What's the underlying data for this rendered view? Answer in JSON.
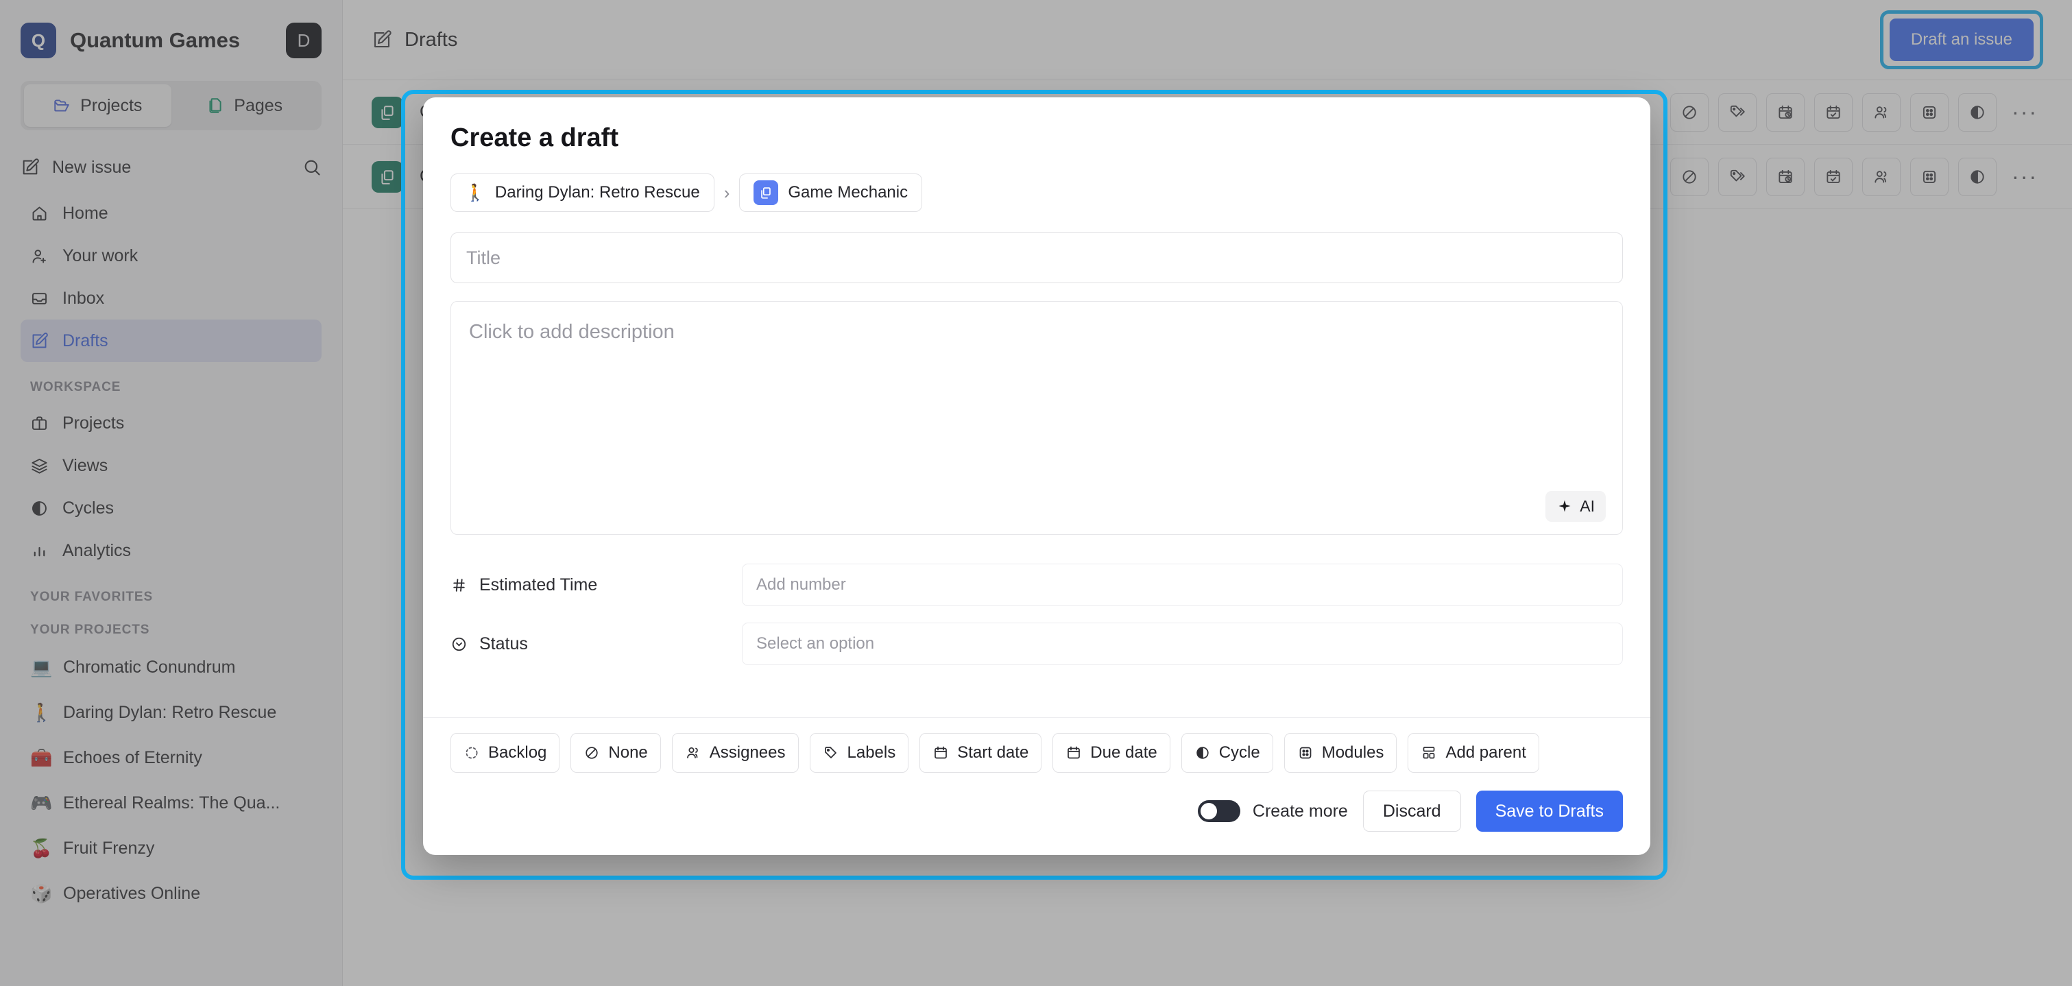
{
  "workspace": {
    "logo_letter": "Q",
    "name": "Quantum Games",
    "avatar_letter": "D"
  },
  "sidebar": {
    "segments": [
      {
        "label": "Projects",
        "icon": "folder-open-icon",
        "active": true
      },
      {
        "label": "Pages",
        "icon": "pages-icon",
        "active": false
      }
    ],
    "new_issue_label": "New issue",
    "search_icon": "search-icon",
    "nav": [
      {
        "label": "Home",
        "icon": "home-icon",
        "active": false
      },
      {
        "label": "Your work",
        "icon": "user-plus-icon",
        "active": false
      },
      {
        "label": "Inbox",
        "icon": "inbox-icon",
        "active": false
      },
      {
        "label": "Drafts",
        "icon": "pencil-square-icon",
        "active": true
      }
    ],
    "workspace_section_label": "WORKSPACE",
    "workspace_items": [
      {
        "label": "Projects",
        "icon": "briefcase-icon"
      },
      {
        "label": "Views",
        "icon": "layers-icon"
      },
      {
        "label": "Cycles",
        "icon": "contrast-circle-icon"
      },
      {
        "label": "Analytics",
        "icon": "bar-chart-icon"
      }
    ],
    "favorites_section_label": "YOUR FAVORITES",
    "projects_section_label": "YOUR PROJECTS",
    "projects": [
      {
        "emoji": "💻",
        "label": "Chromatic Conundrum"
      },
      {
        "emoji": "🚶",
        "label": "Daring Dylan: Retro Rescue"
      },
      {
        "emoji": "🧰",
        "label": "Echoes of Eternity"
      },
      {
        "emoji": "🎮",
        "label": "Ethereal Realms: The Qua..."
      },
      {
        "emoji": "🍒",
        "label": "Fruit Frenzy"
      },
      {
        "emoji": "🎲",
        "label": "Operatives Online"
      }
    ]
  },
  "header": {
    "title": "Drafts",
    "title_icon": "pencil-square-icon",
    "draft_issue_button": "Draft an issue",
    "highlight_color": "#17b0f0",
    "primary_color": "#3b6cf0"
  },
  "draft_rows": [
    {
      "title": "CH"
    },
    {
      "title": "CH"
    }
  ],
  "row_prop_icons": [
    "priority-none-icon",
    "labels-icon",
    "start-date-icon",
    "due-date-icon",
    "assignees-icon",
    "modules-icon",
    "cycle-icon"
  ],
  "row_more_label": "···",
  "modal": {
    "heading": "Create a draft",
    "breadcrumb": [
      {
        "emoji": "🚶",
        "label": "Daring Dylan: Retro Rescue",
        "type": "emoji"
      },
      {
        "label": "Game Mechanic",
        "type": "square",
        "square_color": "#5b7ef2"
      }
    ],
    "breadcrumb_separator": "›",
    "title_placeholder": "Title",
    "title_value": "",
    "description_placeholder": "Click to add description",
    "ai_button_label": "AI",
    "ai_icon": "sparkle-icon",
    "properties": [
      {
        "label": "Estimated Time",
        "icon": "hash-icon",
        "placeholder": "Add number"
      },
      {
        "label": "Status",
        "icon": "chevron-circle-down-icon",
        "placeholder": "Select an option"
      }
    ],
    "option_chips": [
      {
        "label": "Backlog",
        "icon": "dashed-circle-icon"
      },
      {
        "label": "None",
        "icon": "circle-slash-icon"
      },
      {
        "label": "Assignees",
        "icon": "assignees-icon"
      },
      {
        "label": "Labels",
        "icon": "tag-icon"
      },
      {
        "label": "Start date",
        "icon": "start-date-icon"
      },
      {
        "label": "Due date",
        "icon": "due-date-icon"
      },
      {
        "label": "Cycle",
        "icon": "contrast-circle-icon"
      },
      {
        "label": "Modules",
        "icon": "modules-icon"
      },
      {
        "label": "Add parent",
        "icon": "add-parent-icon"
      }
    ],
    "create_more_label": "Create more",
    "create_more_on": false,
    "discard_label": "Discard",
    "save_label": "Save to Drafts"
  }
}
